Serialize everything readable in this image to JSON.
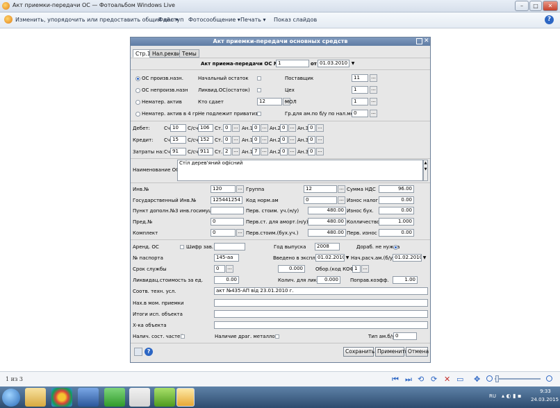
{
  "window": {
    "title": "Акт приемки-передачи ОС — Фотоальбом Windows Live",
    "min": "–",
    "max": "□",
    "close": "✕"
  },
  "toolbar": {
    "share": "Изменить, упорядочить или предоставить общий доступ",
    "file": "Файл ▾",
    "photo": "Фотосообщение ▾",
    "print": "Печать ▾",
    "slideshow": "Показ слайдов",
    "help": "?"
  },
  "dialog": {
    "title": "Акт приемки-передачи основных средств",
    "tabs": [
      "Стр.1",
      "Нал.реквиз.",
      "Темы"
    ],
    "act_label": "Акт приема-передачи ОС №",
    "act_no": "1",
    "from_label": "от",
    "act_date": "01.03.2010",
    "radios": [
      "ОС произв.назн.",
      "ОС непроизв.назн",
      "Нематер. актив",
      "Нематер. актив в 4 гр."
    ],
    "mid_labels": [
      "Начальный остаток",
      "Ликвид.ОС(остаток)",
      "Кто сдает",
      "Не подлежит приватиз."
    ],
    "kto_sdaet": "12",
    "right_labels": [
      "Поставщик",
      "Цех",
      "МОЛ",
      "Гр.для ам.по б/у по нал.мет"
    ],
    "right_vals": [
      "11",
      "1",
      "1",
      "0"
    ],
    "acc_rows": [
      {
        "label": "Дебет:",
        "sch": "10",
        "csch": "106",
        "st": "0",
        "an1": "0",
        "an2": "0",
        "an3": "0"
      },
      {
        "label": "Кредит:",
        "sch": "15",
        "csch": "152",
        "st": "0",
        "an1": "0",
        "an2": "0",
        "an3": "0"
      },
      {
        "label": "Затраты на:",
        "sch": "91",
        "csch": "911",
        "st": "2",
        "an1": "7",
        "an2": "0",
        "an3": "0"
      }
    ],
    "acc_col": {
      "sch": "Сч",
      "csch": "С/сч",
      "st": "Ст.",
      "an1": "Ан.1",
      "an2": "Ан.2",
      "an3": "Ан.3"
    },
    "name_label": "Наименование ОС",
    "name_value": "Стіл дерев'яний офісний",
    "grid": [
      {
        "l1": "Инв.№",
        "v1": "120",
        "l2": "Группа",
        "v2": "12",
        "l3": "Сумма НДС",
        "v3": "96.00"
      },
      {
        "l1": "Государственный Инв.№",
        "v1": "125441254",
        "l2": "Код норм.ам",
        "v2": "0",
        "l3": "Износ налог.",
        "v3": "0.00"
      },
      {
        "l1": "Пункт дополн.№3 инв.госимущ.",
        "v1": "",
        "l2": "Перв. стоим. уч.(н/у)",
        "v2": "480.00",
        "l3": "Износ бух.",
        "v3": "0.00"
      },
      {
        "l1": "Пред.№",
        "v1": "0",
        "l2": "Перв.ст. для аморт.(н/у)",
        "v2": "480.00",
        "l3": "Колличество",
        "v3": "1.000"
      },
      {
        "l1": "Комплект",
        "v1": "0",
        "l2": "Перв.стоим.(бух.уч.)",
        "v2": "480.00",
        "l3": "Перв. износ НДС",
        "v3": "0.00"
      }
    ],
    "arend_label": "Аренд. ОС",
    "shifr_label": "Шифр зав.",
    "god_label": "Год выпуска",
    "god": "2008",
    "dorab_label": "Дораб. не нужна",
    "passport_label": "№ паспорта",
    "passport": "145-аа",
    "vved_label": "Введено в экспл.",
    "vved": "01.02.2010",
    "nach_label": "Нач.расч.ам.(б/у)",
    "nach": "01.02.2010",
    "srok_label": "Срок службы",
    "srok": "0",
    "zero_val": "0.000",
    "obor_label": "Обор.(код КОФ)",
    "obor": "1",
    "likv_label": "Ликвидац.стоимость за ед.",
    "likv": "0.00",
    "koliv_label": "Колич. для ликв.",
    "koliv": "0.000",
    "popr_label": "Поправ.коэфф.",
    "popr": "1.00",
    "sootv_label": "Соотв. техн. усл.",
    "sootv": "акт №435-АП від 23.01.2010 г.",
    "nah_label": "Нах.в мом. приемки",
    "itogi_label": "Итоги исп. объекта",
    "xka_label": "Х-ка объекта",
    "nalich_label": "Налич. сост. частей",
    "drag_label": "Наличие драг. металлов",
    "tip_label": "Тип ам.б/у",
    "tip": "0",
    "save": "Сохранить",
    "apply": "Применить",
    "cancel": "Отмена"
  },
  "status": {
    "page": "1 из 3"
  },
  "tray": {
    "lang": "RU",
    "time": "9:33",
    "date": "24.03.2015"
  }
}
